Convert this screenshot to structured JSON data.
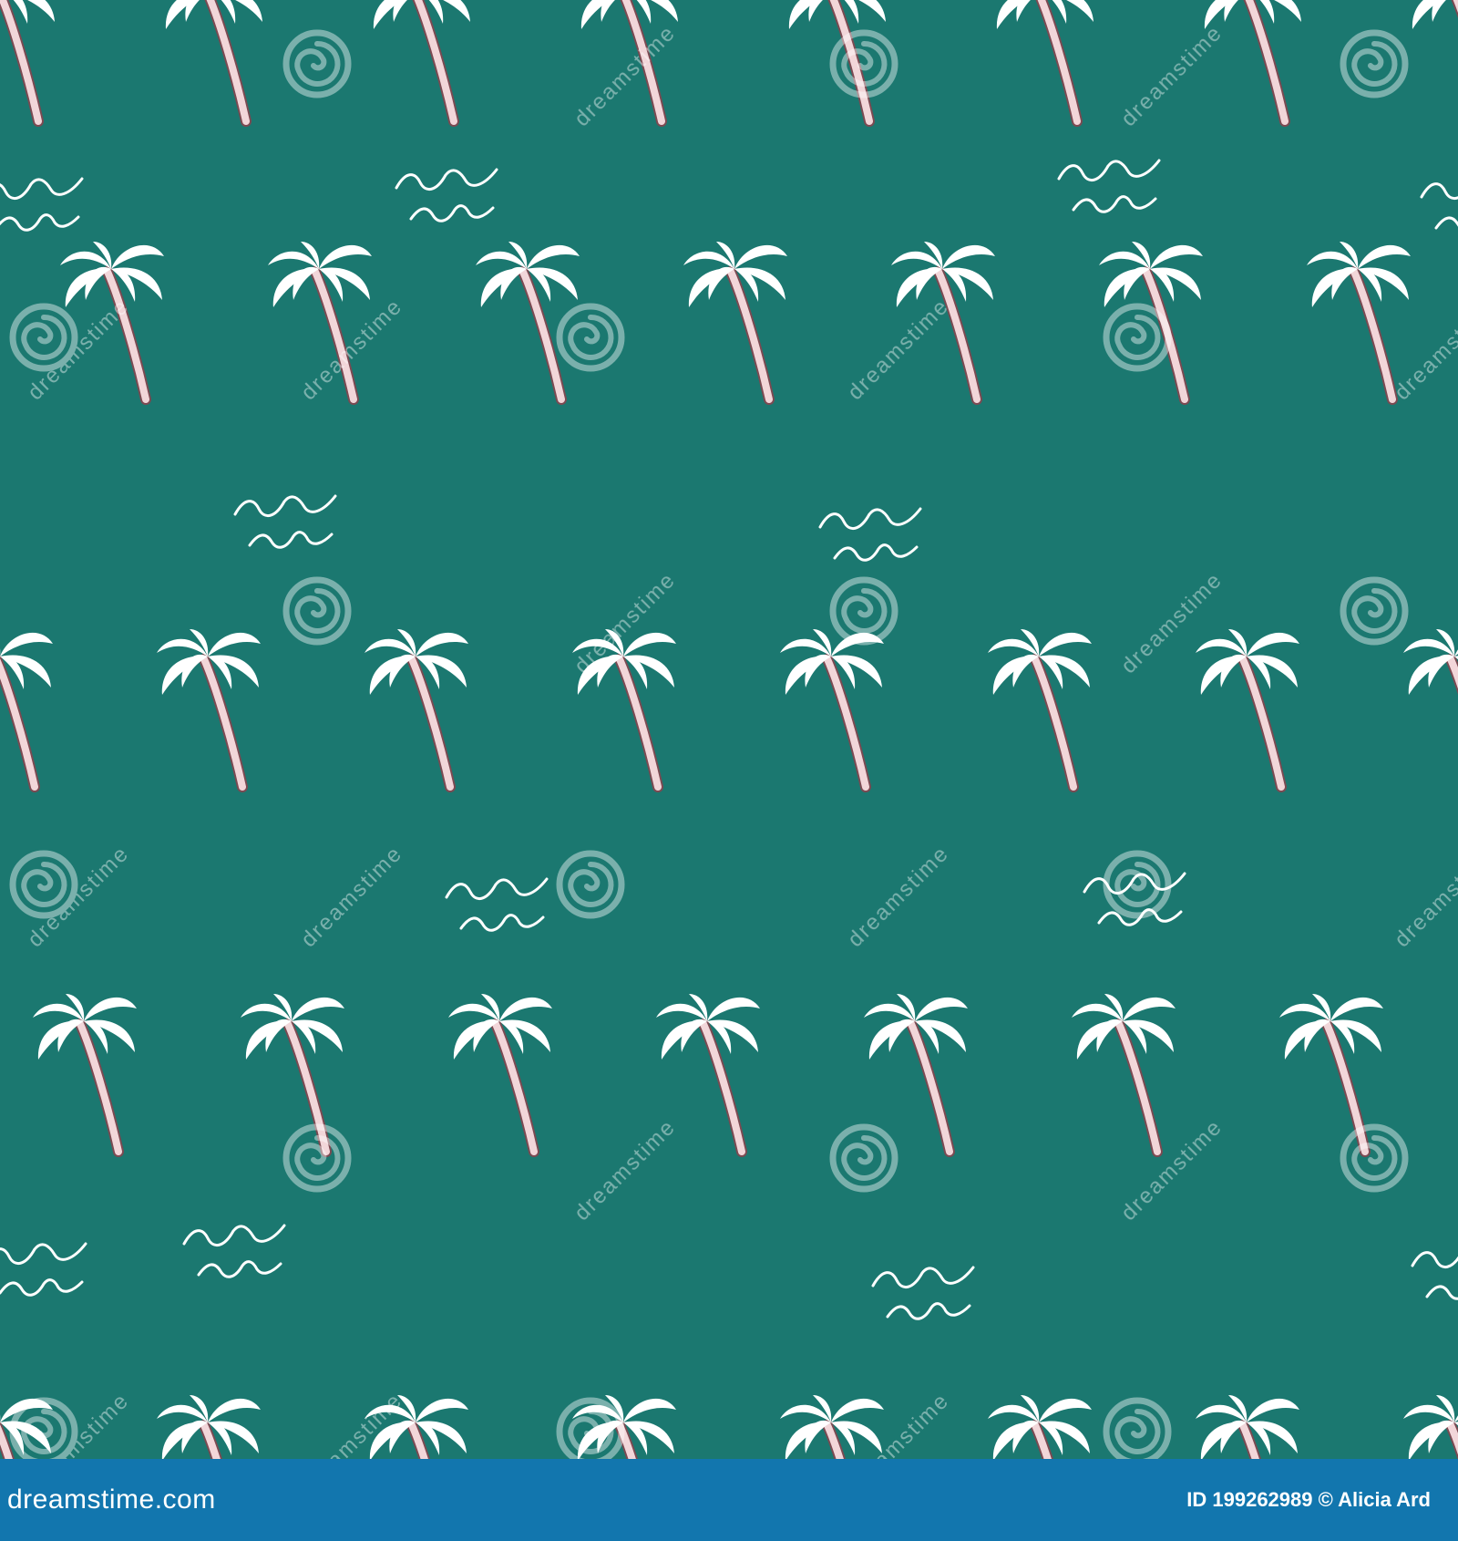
{
  "colors": {
    "background": "#1b7870",
    "leaf": "#ffffff",
    "trunk": "#f2d6d9",
    "trunk_stroke": "#7b4a52",
    "wave": "#ffffff",
    "footer": "#1276ae",
    "watermark": "#ffffff"
  },
  "pattern": {
    "motifs": [
      "palm-tree-icon",
      "wave-icon"
    ],
    "watermark_icon": "spiral-logo-icon",
    "watermark_text": "dreamstime"
  },
  "footer": {
    "brand": "dreamstime.com",
    "credit": "ID 199262989 © Alicia Ard"
  }
}
